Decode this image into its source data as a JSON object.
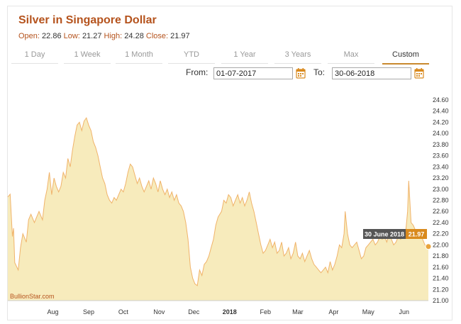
{
  "header": {
    "title": "Silver in Singapore Dollar",
    "ohlc": {
      "open_label": "Open:",
      "open": "22.86",
      "low_label": "Low:",
      "low": "21.27",
      "high_label": "High:",
      "high": "24.28",
      "close_label": "Close:",
      "close": "21.97"
    }
  },
  "tabs": [
    {
      "label": "1 Day"
    },
    {
      "label": "1 Week"
    },
    {
      "label": "1 Month"
    },
    {
      "label": "YTD"
    },
    {
      "label": "1 Year"
    },
    {
      "label": "3 Years"
    },
    {
      "label": "Max"
    },
    {
      "label": "Custom",
      "active": true
    }
  ],
  "date_range": {
    "from_label": "From:",
    "from_value": "01-07-2017",
    "to_label": "To:",
    "to_value": "30-06-2018"
  },
  "colors": {
    "accent": "#b5531d",
    "area_fill": "#f7ebbc",
    "line": "#f0b36a",
    "marker": "#e8a33c",
    "tooltip_bg": "#555555",
    "tooltip_value_bg": "#d98a1e"
  },
  "tooltip": {
    "date": "30 June 2018",
    "value": "21.97"
  },
  "watermark": "BullionStar.com",
  "chart_data": {
    "type": "area",
    "ylim": [
      21.0,
      24.6
    ],
    "y_ticks": [
      "21.00",
      "21.20",
      "21.40",
      "21.60",
      "21.80",
      "22.00",
      "22.20",
      "22.40",
      "22.60",
      "22.80",
      "23.00",
      "23.20",
      "23.40",
      "23.60",
      "23.80",
      "24.00",
      "24.20",
      "24.40",
      "24.60"
    ],
    "x_ticks": [
      {
        "label": "Aug",
        "date": "2017-08-01"
      },
      {
        "label": "Sep",
        "date": "2017-09-01"
      },
      {
        "label": "Oct",
        "date": "2017-10-01"
      },
      {
        "label": "Nov",
        "date": "2017-11-01"
      },
      {
        "label": "Dec",
        "date": "2017-12-01"
      },
      {
        "label": "2018",
        "date": "2018-01-01",
        "bold": true
      },
      {
        "label": "Feb",
        "date": "2018-02-01"
      },
      {
        "label": "Mar",
        "date": "2018-03-01"
      },
      {
        "label": "Apr",
        "date": "2018-04-01"
      },
      {
        "label": "May",
        "date": "2018-05-01"
      },
      {
        "label": "Jun",
        "date": "2018-06-01"
      }
    ],
    "x_range": [
      "2017-07-01",
      "2018-06-30"
    ],
    "series": [
      {
        "points": [
          [
            "2017-07-01",
            22.86
          ],
          [
            "2017-07-03",
            22.91
          ],
          [
            "2017-07-05",
            22.15
          ],
          [
            "2017-07-06",
            22.3
          ],
          [
            "2017-07-07",
            21.68
          ],
          [
            "2017-07-10",
            21.55
          ],
          [
            "2017-07-12",
            21.95
          ],
          [
            "2017-07-14",
            22.2
          ],
          [
            "2017-07-17",
            22.05
          ],
          [
            "2017-07-19",
            22.45
          ],
          [
            "2017-07-21",
            22.55
          ],
          [
            "2017-07-24",
            22.4
          ],
          [
            "2017-07-26",
            22.5
          ],
          [
            "2017-07-28",
            22.6
          ],
          [
            "2017-07-31",
            22.45
          ],
          [
            "2017-08-02",
            22.8
          ],
          [
            "2017-08-04",
            23.0
          ],
          [
            "2017-08-06",
            23.3
          ],
          [
            "2017-08-08",
            22.9
          ],
          [
            "2017-08-10",
            23.2
          ],
          [
            "2017-08-12",
            23.05
          ],
          [
            "2017-08-14",
            22.95
          ],
          [
            "2017-08-16",
            23.05
          ],
          [
            "2017-08-18",
            23.3
          ],
          [
            "2017-08-20",
            23.2
          ],
          [
            "2017-08-22",
            23.55
          ],
          [
            "2017-08-24",
            23.4
          ],
          [
            "2017-08-26",
            23.7
          ],
          [
            "2017-08-28",
            23.95
          ],
          [
            "2017-08-30",
            24.15
          ],
          [
            "2017-09-01",
            24.2
          ],
          [
            "2017-09-03",
            24.05
          ],
          [
            "2017-09-05",
            24.22
          ],
          [
            "2017-09-07",
            24.28
          ],
          [
            "2017-09-09",
            24.15
          ],
          [
            "2017-09-11",
            24.05
          ],
          [
            "2017-09-13",
            23.85
          ],
          [
            "2017-09-15",
            23.75
          ],
          [
            "2017-09-17",
            23.6
          ],
          [
            "2017-09-19",
            23.4
          ],
          [
            "2017-09-21",
            23.2
          ],
          [
            "2017-09-23",
            23.1
          ],
          [
            "2017-09-25",
            22.9
          ],
          [
            "2017-09-27",
            22.8
          ],
          [
            "2017-09-29",
            22.75
          ],
          [
            "2017-10-01",
            22.85
          ],
          [
            "2017-10-03",
            22.8
          ],
          [
            "2017-10-05",
            22.9
          ],
          [
            "2017-10-07",
            23.0
          ],
          [
            "2017-10-09",
            22.95
          ],
          [
            "2017-10-11",
            23.1
          ],
          [
            "2017-10-13",
            23.3
          ],
          [
            "2017-10-15",
            23.45
          ],
          [
            "2017-10-17",
            23.4
          ],
          [
            "2017-10-19",
            23.25
          ],
          [
            "2017-10-21",
            23.1
          ],
          [
            "2017-10-23",
            23.2
          ],
          [
            "2017-10-25",
            23.05
          ],
          [
            "2017-10-27",
            22.95
          ],
          [
            "2017-10-29",
            23.05
          ],
          [
            "2017-10-31",
            23.15
          ],
          [
            "2017-11-02",
            23.0
          ],
          [
            "2017-11-04",
            23.2
          ],
          [
            "2017-11-06",
            23.1
          ],
          [
            "2017-11-08",
            22.95
          ],
          [
            "2017-11-10",
            23.15
          ],
          [
            "2017-11-12",
            23.0
          ],
          [
            "2017-11-14",
            22.9
          ],
          [
            "2017-11-16",
            23.0
          ],
          [
            "2017-11-18",
            22.85
          ],
          [
            "2017-11-20",
            22.95
          ],
          [
            "2017-11-22",
            22.8
          ],
          [
            "2017-11-24",
            22.9
          ],
          [
            "2017-11-26",
            22.75
          ],
          [
            "2017-11-28",
            22.7
          ],
          [
            "2017-11-30",
            22.6
          ],
          [
            "2017-12-02",
            22.4
          ],
          [
            "2017-12-04",
            22.1
          ],
          [
            "2017-12-06",
            21.6
          ],
          [
            "2017-12-08",
            21.4
          ],
          [
            "2017-12-10",
            21.3
          ],
          [
            "2017-12-12",
            21.27
          ],
          [
            "2017-12-14",
            21.55
          ],
          [
            "2017-12-16",
            21.45
          ],
          [
            "2017-12-18",
            21.65
          ],
          [
            "2017-12-20",
            21.7
          ],
          [
            "2017-12-22",
            21.8
          ],
          [
            "2017-12-24",
            21.95
          ],
          [
            "2017-12-26",
            22.1
          ],
          [
            "2017-12-28",
            22.35
          ],
          [
            "2017-12-30",
            22.5
          ],
          [
            "2018-01-02",
            22.6
          ],
          [
            "2018-01-04",
            22.8
          ],
          [
            "2018-01-06",
            22.75
          ],
          [
            "2018-01-08",
            22.9
          ],
          [
            "2018-01-10",
            22.85
          ],
          [
            "2018-01-12",
            22.7
          ],
          [
            "2018-01-14",
            22.8
          ],
          [
            "2018-01-16",
            22.9
          ],
          [
            "2018-01-18",
            22.75
          ],
          [
            "2018-01-20",
            22.85
          ],
          [
            "2018-01-22",
            22.7
          ],
          [
            "2018-01-24",
            22.8
          ],
          [
            "2018-01-26",
            22.95
          ],
          [
            "2018-01-28",
            22.75
          ],
          [
            "2018-01-30",
            22.6
          ],
          [
            "2018-02-01",
            22.4
          ],
          [
            "2018-02-03",
            22.2
          ],
          [
            "2018-02-05",
            22.0
          ],
          [
            "2018-02-07",
            21.85
          ],
          [
            "2018-02-09",
            21.9
          ],
          [
            "2018-02-11",
            22.0
          ],
          [
            "2018-02-13",
            22.1
          ],
          [
            "2018-02-15",
            21.95
          ],
          [
            "2018-02-17",
            22.05
          ],
          [
            "2018-02-19",
            21.85
          ],
          [
            "2018-02-21",
            21.9
          ],
          [
            "2018-02-23",
            22.05
          ],
          [
            "2018-02-25",
            21.8
          ],
          [
            "2018-02-27",
            21.85
          ],
          [
            "2018-03-01",
            21.95
          ],
          [
            "2018-03-03",
            21.75
          ],
          [
            "2018-03-05",
            21.85
          ],
          [
            "2018-03-07",
            22.05
          ],
          [
            "2018-03-09",
            21.8
          ],
          [
            "2018-03-11",
            21.75
          ],
          [
            "2018-03-13",
            21.85
          ],
          [
            "2018-03-15",
            21.7
          ],
          [
            "2018-03-17",
            21.8
          ],
          [
            "2018-03-19",
            21.9
          ],
          [
            "2018-03-21",
            21.75
          ],
          [
            "2018-03-23",
            21.65
          ],
          [
            "2018-03-25",
            21.6
          ],
          [
            "2018-03-27",
            21.55
          ],
          [
            "2018-03-29",
            21.5
          ],
          [
            "2018-03-31",
            21.55
          ],
          [
            "2018-04-02",
            21.6
          ],
          [
            "2018-04-04",
            21.5
          ],
          [
            "2018-04-06",
            21.7
          ],
          [
            "2018-04-08",
            21.55
          ],
          [
            "2018-04-10",
            21.65
          ],
          [
            "2018-04-12",
            21.8
          ],
          [
            "2018-04-14",
            22.0
          ],
          [
            "2018-04-16",
            21.95
          ],
          [
            "2018-04-18",
            22.2
          ],
          [
            "2018-04-19",
            22.6
          ],
          [
            "2018-04-21",
            22.2
          ],
          [
            "2018-04-23",
            22.0
          ],
          [
            "2018-04-25",
            21.95
          ],
          [
            "2018-04-27",
            22.0
          ],
          [
            "2018-04-29",
            22.05
          ],
          [
            "2018-05-01",
            21.9
          ],
          [
            "2018-05-03",
            21.75
          ],
          [
            "2018-05-05",
            21.8
          ],
          [
            "2018-05-07",
            21.95
          ],
          [
            "2018-05-09",
            22.0
          ],
          [
            "2018-05-11",
            22.05
          ],
          [
            "2018-05-13",
            22.1
          ],
          [
            "2018-05-15",
            22.0
          ],
          [
            "2018-05-17",
            22.05
          ],
          [
            "2018-05-19",
            22.15
          ],
          [
            "2018-05-21",
            22.1
          ],
          [
            "2018-05-23",
            22.15
          ],
          [
            "2018-05-25",
            22.05
          ],
          [
            "2018-05-27",
            22.2
          ],
          [
            "2018-05-29",
            22.1
          ],
          [
            "2018-05-31",
            22.0
          ],
          [
            "2018-06-02",
            22.05
          ],
          [
            "2018-06-04",
            22.15
          ],
          [
            "2018-06-06",
            22.1
          ],
          [
            "2018-06-08",
            22.2
          ],
          [
            "2018-06-10",
            22.15
          ],
          [
            "2018-06-12",
            22.6
          ],
          [
            "2018-06-13",
            23.15
          ],
          [
            "2018-06-15",
            22.4
          ],
          [
            "2018-06-17",
            22.35
          ],
          [
            "2018-06-19",
            22.25
          ],
          [
            "2018-06-21",
            22.2
          ],
          [
            "2018-06-23",
            22.15
          ],
          [
            "2018-06-25",
            22.1
          ],
          [
            "2018-06-27",
            22.0
          ],
          [
            "2018-06-30",
            21.97
          ]
        ]
      }
    ]
  }
}
